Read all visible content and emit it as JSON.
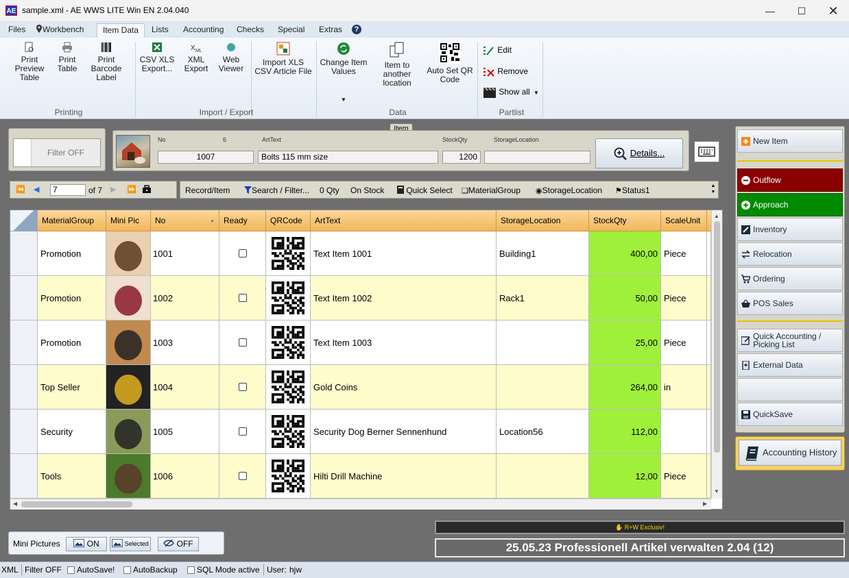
{
  "window": {
    "title": "sample.xml - AE WWS LITE Win EN 2.04.040",
    "app_icon": "AE"
  },
  "menu": {
    "tabs": [
      "Files",
      "Workbench",
      "Item Data",
      "Lists",
      "Accounting",
      "Checks",
      "Special",
      "Extras"
    ],
    "active": "Item Data"
  },
  "ribbon": {
    "printing": {
      "label": "Printing",
      "preview": "Print Preview Table",
      "print": "Print Table",
      "barcode": "Print Barcode Label"
    },
    "import_export": {
      "label": "Import / Export",
      "csv": "CSV XLS Export...",
      "xml": "XML Export",
      "web": "Web Viewer",
      "import": "Import XLS CSV Article File"
    },
    "data": {
      "label": "Data",
      "change": "Change Item Values",
      "move": "Item to another location",
      "qr": "Auto Set QR Code"
    },
    "partlist": {
      "label": "Partlist",
      "edit": "Edit",
      "remove": "Remove",
      "show_all": "Show all"
    }
  },
  "item_tab_label": "Item",
  "filter": {
    "label": "Filter OFF"
  },
  "item_detail": {
    "no_label": "No",
    "no_counter": "6",
    "no_value": "1007",
    "arttext_label": "ArtText",
    "arttext_value": "Bolts 115 mm size",
    "stockqty_label": "StockQty",
    "stockqty_value": "1200",
    "storage_label": "StorageLocation",
    "storage_value": "",
    "details_label": "Details..."
  },
  "navigator": {
    "record": "7",
    "of": "of 7",
    "record_item": "Record/Item",
    "search": "Search / Filter...",
    "zero_qty": "0 Qty",
    "on_stock": "On Stock",
    "quick_select": "Quick Select",
    "material_group": "MaterialGroup",
    "storage_location": "StorageLocation",
    "status": "Status1"
  },
  "grid": {
    "columns": [
      "MaterialGroup",
      "Mini Pic",
      "No",
      "Ready",
      "QRCode",
      "ArtText",
      "StorageLocation",
      "StockQty",
      "ScaleUnit"
    ],
    "rows": [
      {
        "group": "Promotion",
        "no": "1001",
        "text": "Text Item 1001",
        "location": "Building1",
        "qty": "400,00",
        "unit": "Piece"
      },
      {
        "group": "Promotion",
        "no": "1002",
        "text": "Text Item 1002",
        "location": "Rack1",
        "qty": "50,00",
        "unit": "Piece"
      },
      {
        "group": "Promotion",
        "no": "1003",
        "text": "Text Item 1003",
        "location": "",
        "qty": "25,00",
        "unit": "Piece"
      },
      {
        "group": "Top Seller",
        "no": "1004",
        "text": "Gold Coins",
        "location": "",
        "qty": "264,00",
        "unit": "in"
      },
      {
        "group": "Security",
        "no": "1005",
        "text": "Security Dog Berner Sennenhund",
        "location": "Location56",
        "qty": "112,00",
        "unit": ""
      },
      {
        "group": "Tools",
        "no": "1006",
        "text": "Hilti Drill Machine",
        "location": "",
        "qty": "12,00",
        "unit": "Piece"
      }
    ]
  },
  "side": {
    "new_item": "New Item",
    "outflow": "Outflow",
    "approach": "Approach",
    "inventory": "Inventory",
    "relocation": "Relocation",
    "ordering": "Ordering",
    "pos": "POS Sales",
    "quick_accounting": "Quick Accounting / Picking List",
    "external": "External Data",
    "quicksave": "QuickSave",
    "history": "Accounting History"
  },
  "mini_pictures": {
    "label": "Mini Pictures",
    "on": "ON",
    "selected": "Selected",
    "off": "OFF"
  },
  "banner": {
    "small": "R+W Exclusiv!",
    "main": "25.05.23 Professionell Artikel verwalten 2.04 (12)"
  },
  "status": {
    "xml": "XML",
    "filter": "Filter OFF",
    "autosave": "AutoSave!",
    "autobackup": "AutoBackup",
    "sql": "SQL Mode active",
    "user_label": "User:",
    "user": "hjw"
  },
  "colors": {
    "header_orange": "#f3b65a",
    "row_yellow": "#fffccc",
    "qty_green": "#9ef03a",
    "outflow_red": "#8b0000",
    "approach_green": "#008a00"
  }
}
